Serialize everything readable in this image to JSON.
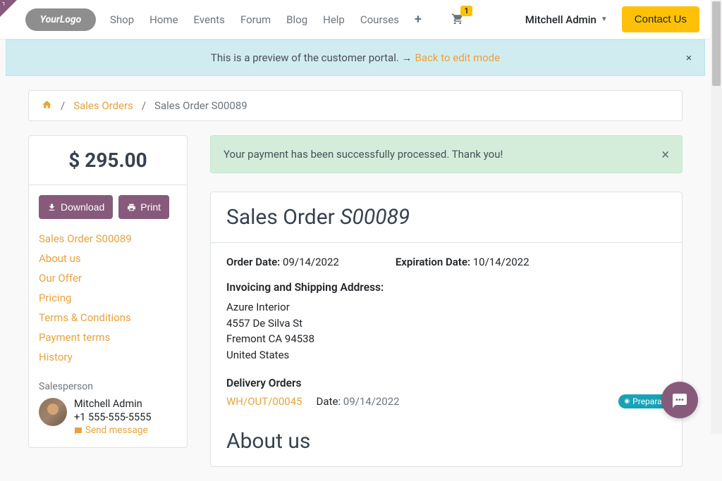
{
  "nav": {
    "shop": "Shop",
    "home": "Home",
    "events": "Events",
    "forum": "Forum",
    "blog": "Blog",
    "help": "Help",
    "courses": "Courses",
    "cart_count": "1",
    "user": "Mitchell Admin",
    "contact": "Contact Us"
  },
  "preview": {
    "text": "This is a preview of the customer portal. ",
    "back": "Back to edit mode"
  },
  "breadcrumb": {
    "sales_orders": "Sales Orders",
    "current": "Sales Order S00089"
  },
  "sidebar": {
    "price": "$ 295.00",
    "download": "Download",
    "print": "Print",
    "anchors": [
      "Sales Order S00089",
      "About us",
      "Our Offer",
      "Pricing",
      "Terms & Conditions",
      "Payment terms",
      "History"
    ],
    "salesperson_label": "Salesperson",
    "salesperson_name": "Mitchell Admin",
    "salesperson_phone": "+1 555-555-5555",
    "send_message": "Send message"
  },
  "alert": {
    "success": "Your payment has been successfully processed. Thank you!"
  },
  "order": {
    "title_prefix": "Sales Order ",
    "title_ref": "S00089",
    "order_date_label": "Order Date:",
    "order_date": "09/14/2022",
    "expiration_label": "Expiration Date:",
    "expiration_date": "10/14/2022",
    "address_label": "Invoicing and Shipping Address:",
    "address_name": "Azure Interior",
    "address_street": "4557 De Silva St",
    "address_city": "Fremont CA 94538",
    "address_country": "United States",
    "delivery_label": "Delivery Orders",
    "delivery_ref": "WH/OUT/00045",
    "delivery_date_label": "Date:",
    "delivery_date": "09/14/2022",
    "prep_badge": "Preparation",
    "about_us": "About us"
  }
}
